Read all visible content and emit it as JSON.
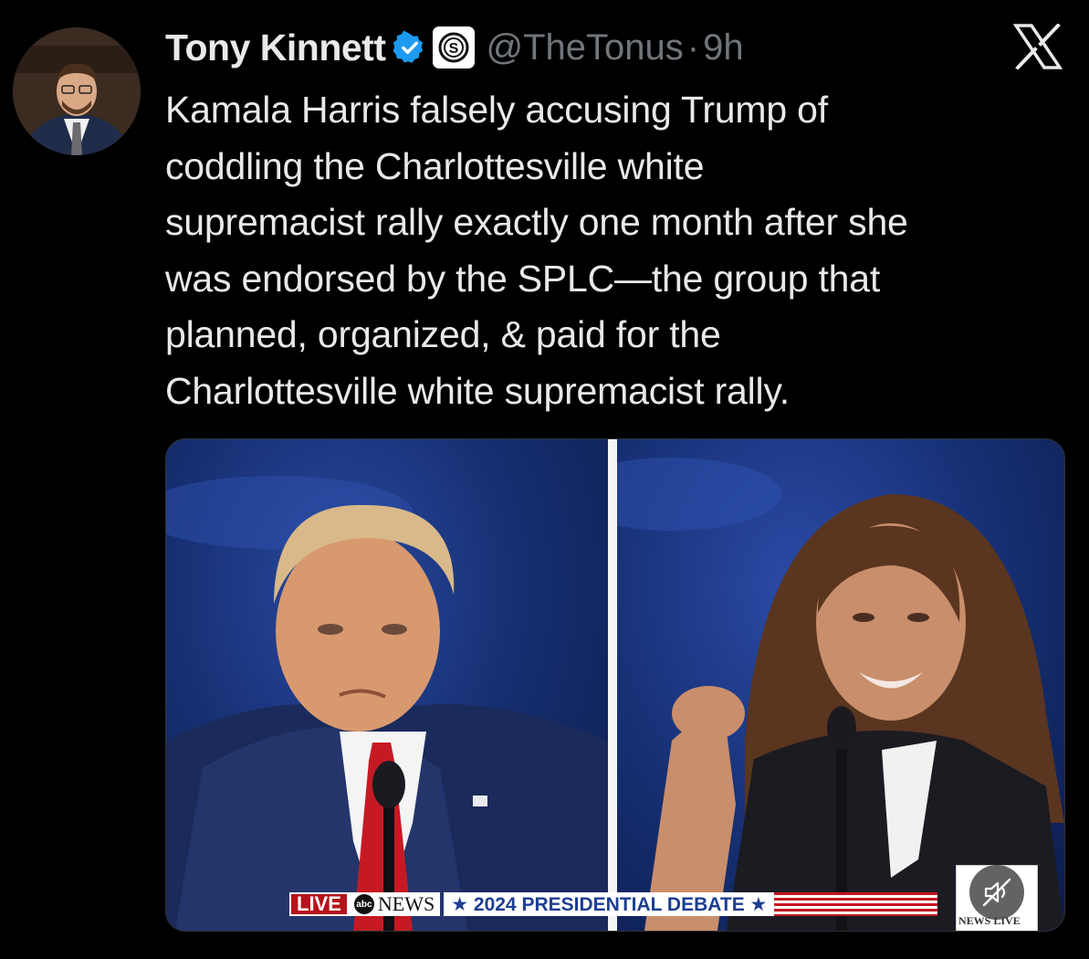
{
  "tweet": {
    "display_name": "Tony Kinnett",
    "handle": "@TheTonus",
    "separator": "·",
    "time": "9h",
    "verified_icon": "verified-badge-icon",
    "affiliate_icon": "dollar-circle-icon",
    "text": "Kamala Harris falsely accusing Trump of\ncoddling the Charlottesville white\nsupremacist rally exactly one month after she\nwas endorsed by the SPLC—the group that\nplanned, organized, & paid for the\nCharlottesville white supremacist rally."
  },
  "platform_icon": "x-logo-icon",
  "media": {
    "live_label": "LIVE",
    "network_label": "NEWS",
    "network_logo_text": "abc",
    "event_label": "★ 2024 PRESIDENTIAL DEBATE ★",
    "corner_label": "NEWS LIVE",
    "mute_icon": "mute-icon"
  },
  "colors": {
    "background": "#000000",
    "text": "#e7e9ea",
    "muted": "#71767b",
    "verified_blue": "#1d9bf0",
    "live_red": "#b5131b",
    "debate_blue": "#1d3e92"
  }
}
